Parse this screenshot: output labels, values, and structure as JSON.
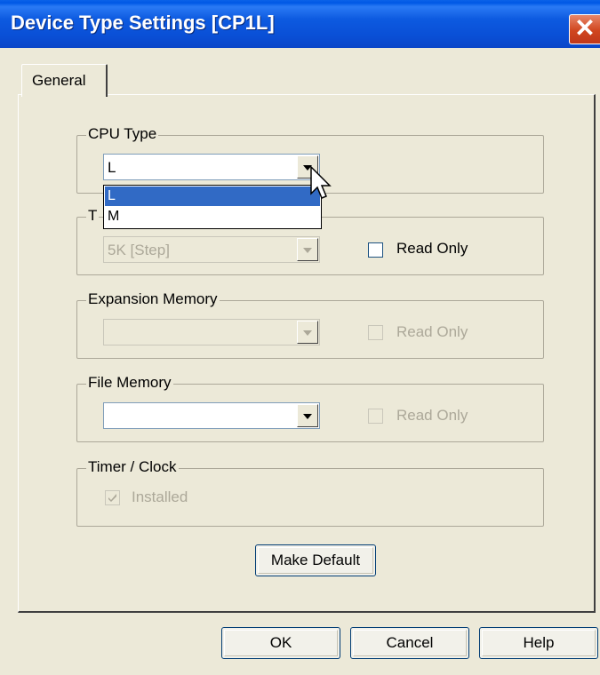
{
  "window": {
    "title": "Device Type Settings [CP1L]",
    "close_glyph": "✕"
  },
  "tabs": [
    {
      "label": "General"
    }
  ],
  "cpu_type": {
    "group_label": "CPU Type",
    "selected": "L",
    "dropdown_open": true,
    "options": [
      "L",
      "M"
    ],
    "highlighted": "L"
  },
  "total_program_area": {
    "group_label_visible": "T",
    "value": "5K [Step]",
    "read_only_label": "Read Only",
    "read_only_checked": false,
    "combo_enabled": false,
    "checkbox_enabled": true
  },
  "expansion_memory": {
    "group_label": "Expansion Memory",
    "value": "",
    "read_only_label": "Read Only",
    "read_only_checked": false,
    "enabled": false
  },
  "file_memory": {
    "group_label": "File Memory",
    "value": "",
    "read_only_label": "Read Only",
    "read_only_checked": false,
    "combo_enabled": true,
    "checkbox_enabled": false
  },
  "timer_clock": {
    "group_label": "Timer / Clock",
    "installed_label": "Installed",
    "installed_checked": true,
    "enabled": false
  },
  "buttons": {
    "make_default": "Make Default",
    "ok": "OK",
    "cancel": "Cancel",
    "help": "Help"
  },
  "colors": {
    "titlebar": "#0a4fd6",
    "dialog_bg": "#ece9d8",
    "selection": "#316ac5",
    "disabled_text": "#aca899",
    "close_button": "#d0461f"
  }
}
